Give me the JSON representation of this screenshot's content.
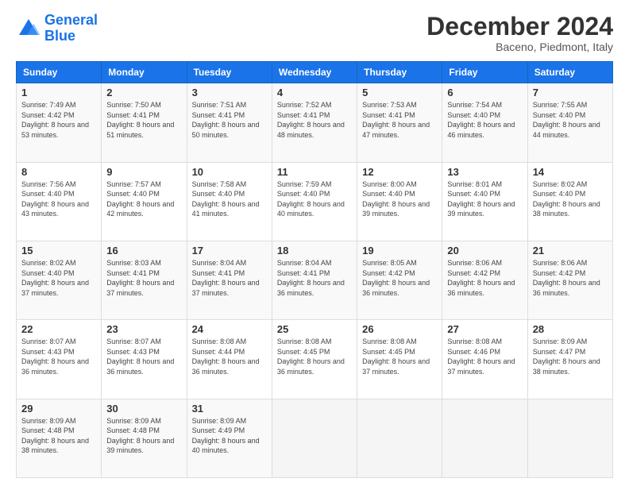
{
  "header": {
    "logo_line1": "General",
    "logo_line2": "Blue",
    "month": "December 2024",
    "location": "Baceno, Piedmont, Italy"
  },
  "days_of_week": [
    "Sunday",
    "Monday",
    "Tuesday",
    "Wednesday",
    "Thursday",
    "Friday",
    "Saturday"
  ],
  "weeks": [
    [
      {
        "day": "1",
        "sunrise": "7:49 AM",
        "sunset": "4:42 PM",
        "daylight": "8 hours and 53 minutes."
      },
      {
        "day": "2",
        "sunrise": "7:50 AM",
        "sunset": "4:41 PM",
        "daylight": "8 hours and 51 minutes."
      },
      {
        "day": "3",
        "sunrise": "7:51 AM",
        "sunset": "4:41 PM",
        "daylight": "8 hours and 50 minutes."
      },
      {
        "day": "4",
        "sunrise": "7:52 AM",
        "sunset": "4:41 PM",
        "daylight": "8 hours and 48 minutes."
      },
      {
        "day": "5",
        "sunrise": "7:53 AM",
        "sunset": "4:41 PM",
        "daylight": "8 hours and 47 minutes."
      },
      {
        "day": "6",
        "sunrise": "7:54 AM",
        "sunset": "4:40 PM",
        "daylight": "8 hours and 46 minutes."
      },
      {
        "day": "7",
        "sunrise": "7:55 AM",
        "sunset": "4:40 PM",
        "daylight": "8 hours and 44 minutes."
      }
    ],
    [
      {
        "day": "8",
        "sunrise": "7:56 AM",
        "sunset": "4:40 PM",
        "daylight": "8 hours and 43 minutes."
      },
      {
        "day": "9",
        "sunrise": "7:57 AM",
        "sunset": "4:40 PM",
        "daylight": "8 hours and 42 minutes."
      },
      {
        "day": "10",
        "sunrise": "7:58 AM",
        "sunset": "4:40 PM",
        "daylight": "8 hours and 41 minutes."
      },
      {
        "day": "11",
        "sunrise": "7:59 AM",
        "sunset": "4:40 PM",
        "daylight": "8 hours and 40 minutes."
      },
      {
        "day": "12",
        "sunrise": "8:00 AM",
        "sunset": "4:40 PM",
        "daylight": "8 hours and 39 minutes."
      },
      {
        "day": "13",
        "sunrise": "8:01 AM",
        "sunset": "4:40 PM",
        "daylight": "8 hours and 39 minutes."
      },
      {
        "day": "14",
        "sunrise": "8:02 AM",
        "sunset": "4:40 PM",
        "daylight": "8 hours and 38 minutes."
      }
    ],
    [
      {
        "day": "15",
        "sunrise": "8:02 AM",
        "sunset": "4:40 PM",
        "daylight": "8 hours and 37 minutes."
      },
      {
        "day": "16",
        "sunrise": "8:03 AM",
        "sunset": "4:41 PM",
        "daylight": "8 hours and 37 minutes."
      },
      {
        "day": "17",
        "sunrise": "8:04 AM",
        "sunset": "4:41 PM",
        "daylight": "8 hours and 37 minutes."
      },
      {
        "day": "18",
        "sunrise": "8:04 AM",
        "sunset": "4:41 PM",
        "daylight": "8 hours and 36 minutes."
      },
      {
        "day": "19",
        "sunrise": "8:05 AM",
        "sunset": "4:42 PM",
        "daylight": "8 hours and 36 minutes."
      },
      {
        "day": "20",
        "sunrise": "8:06 AM",
        "sunset": "4:42 PM",
        "daylight": "8 hours and 36 minutes."
      },
      {
        "day": "21",
        "sunrise": "8:06 AM",
        "sunset": "4:42 PM",
        "daylight": "8 hours and 36 minutes."
      }
    ],
    [
      {
        "day": "22",
        "sunrise": "8:07 AM",
        "sunset": "4:43 PM",
        "daylight": "8 hours and 36 minutes."
      },
      {
        "day": "23",
        "sunrise": "8:07 AM",
        "sunset": "4:43 PM",
        "daylight": "8 hours and 36 minutes."
      },
      {
        "day": "24",
        "sunrise": "8:08 AM",
        "sunset": "4:44 PM",
        "daylight": "8 hours and 36 minutes."
      },
      {
        "day": "25",
        "sunrise": "8:08 AM",
        "sunset": "4:45 PM",
        "daylight": "8 hours and 36 minutes."
      },
      {
        "day": "26",
        "sunrise": "8:08 AM",
        "sunset": "4:45 PM",
        "daylight": "8 hours and 37 minutes."
      },
      {
        "day": "27",
        "sunrise": "8:08 AM",
        "sunset": "4:46 PM",
        "daylight": "8 hours and 37 minutes."
      },
      {
        "day": "28",
        "sunrise": "8:09 AM",
        "sunset": "4:47 PM",
        "daylight": "8 hours and 38 minutes."
      }
    ],
    [
      {
        "day": "29",
        "sunrise": "8:09 AM",
        "sunset": "4:48 PM",
        "daylight": "8 hours and 38 minutes."
      },
      {
        "day": "30",
        "sunrise": "8:09 AM",
        "sunset": "4:48 PM",
        "daylight": "8 hours and 39 minutes."
      },
      {
        "day": "31",
        "sunrise": "8:09 AM",
        "sunset": "4:49 PM",
        "daylight": "8 hours and 40 minutes."
      },
      null,
      null,
      null,
      null
    ]
  ]
}
